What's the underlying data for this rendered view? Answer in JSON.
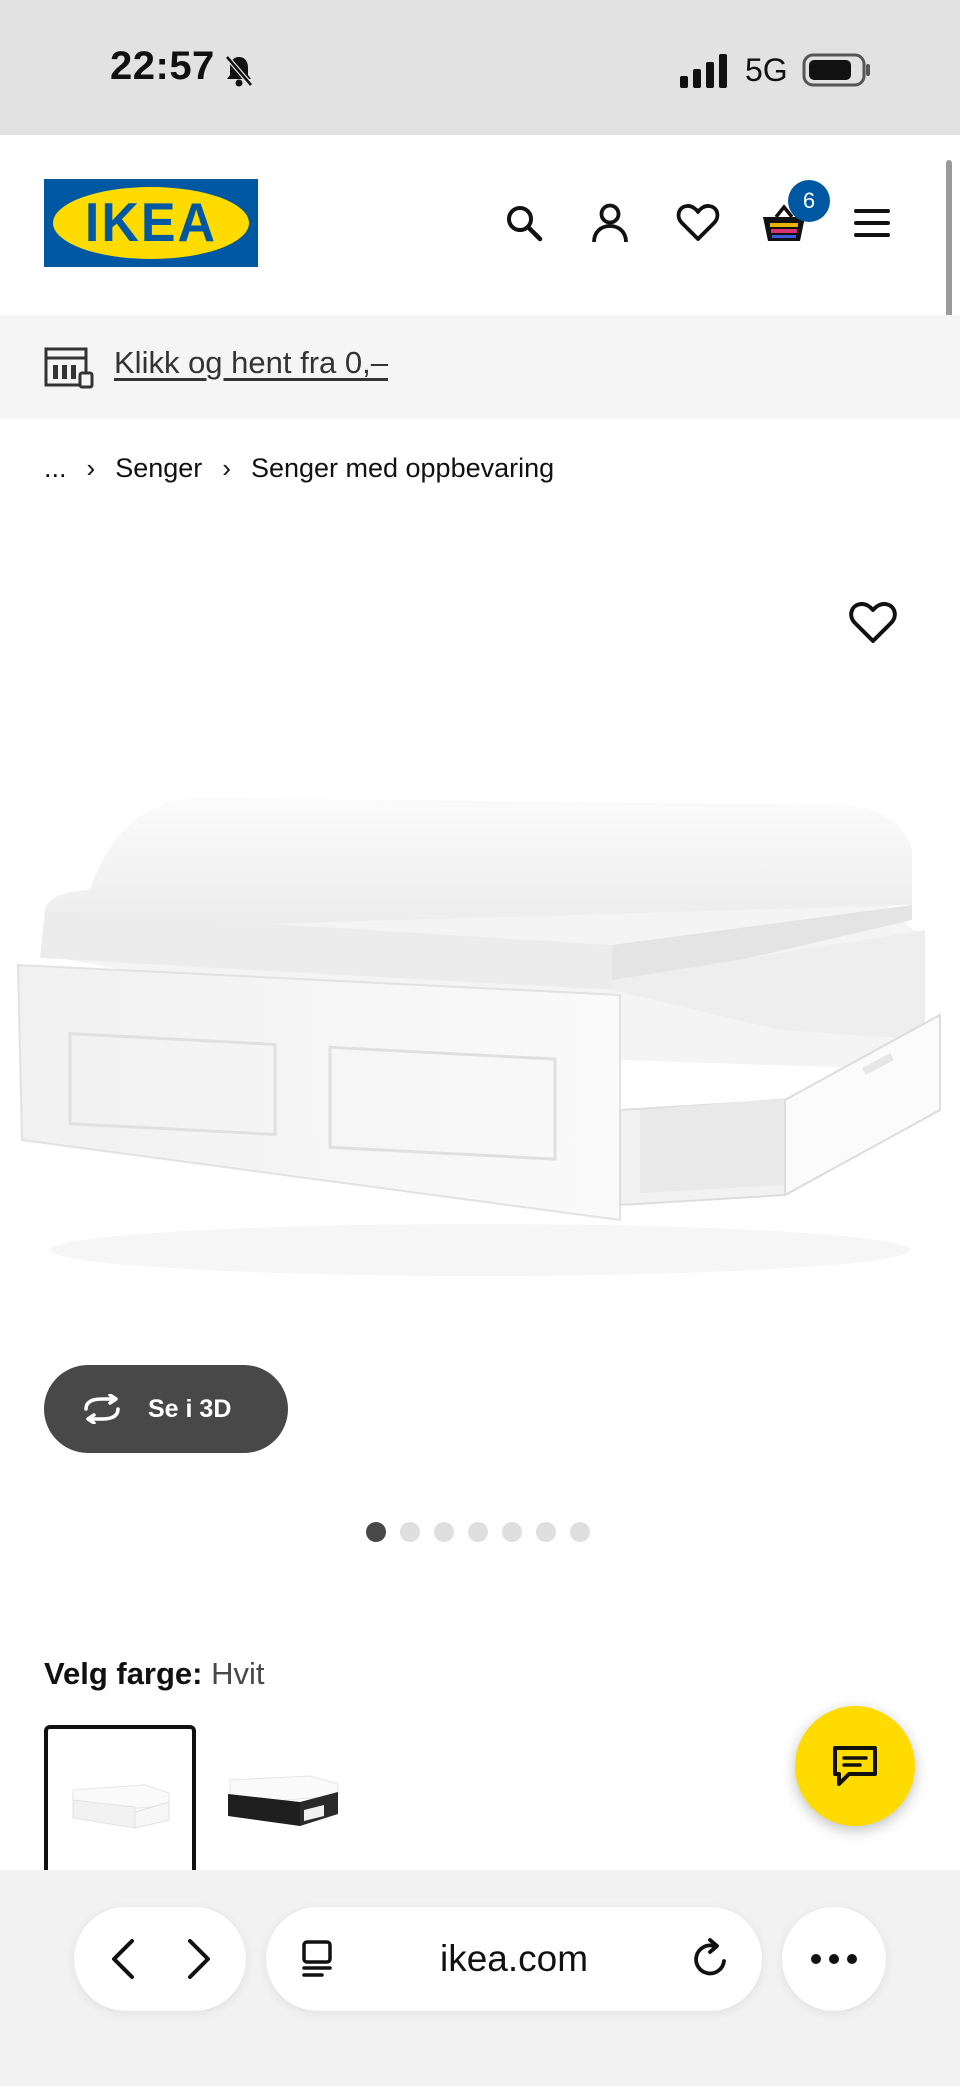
{
  "status": {
    "time": "22:57",
    "network": "5G",
    "icons": [
      "bell-off-icon",
      "signal-icon",
      "battery-icon"
    ]
  },
  "header": {
    "logo_text": "IKEA",
    "icons": [
      "search-icon",
      "account-icon",
      "heart-icon",
      "cart-icon",
      "menu-icon"
    ],
    "cart_count": "6",
    "colors": {
      "brand_blue": "#0058a3",
      "brand_yellow": "#ffdb00"
    }
  },
  "promo": {
    "icon": "store-icon",
    "link_text": "Klikk og hent fra 0,–"
  },
  "breadcrumb": {
    "items": [
      "...",
      "Senger",
      "Senger med oppbevaring"
    ]
  },
  "product": {
    "favourite_icon": "heart-icon",
    "view_3d_label": "Se i 3D",
    "image_count": 7,
    "active_image": 1
  },
  "color_picker": {
    "label": "Velg farge:",
    "value": "Hvit",
    "swatches": [
      "white",
      "black"
    ],
    "selected": "white"
  },
  "chat": {
    "icon": "chat-icon"
  },
  "browser": {
    "url": "ikea.com",
    "icons": [
      "back-icon",
      "forward-icon",
      "tabs-icon",
      "reload-icon",
      "more-icon"
    ]
  }
}
